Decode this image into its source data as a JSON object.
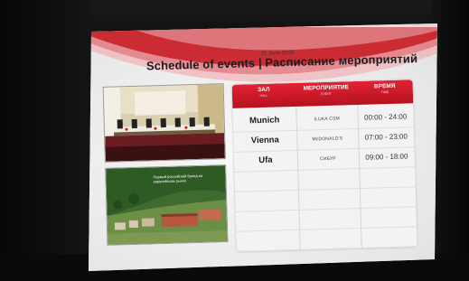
{
  "sign": {
    "date": "15 June 2018",
    "title": "Schedule of events | Расписание мероприятий",
    "headers": {
      "hall_ru": "ЗАЛ",
      "hall_en": "HALL",
      "event_ru": "МЕРОПРИЯТИЕ",
      "event_en": "EVENT",
      "time_ru": "ВРЕМЯ",
      "time_en": "TIME"
    },
    "rows": [
      {
        "hall": "Munich",
        "event": "ILUKA CSM",
        "time": "00:00 - 24:00"
      },
      {
        "hall": "Vienna",
        "event": "McDONALD'S",
        "time": "07:00 - 23:00"
      },
      {
        "hall": "Ufa",
        "event": "СИБУР",
        "time": "09:00 - 18:00"
      }
    ],
    "photo2_caption": "Первый российский бренд на европейском рынке"
  },
  "colors": {
    "accent_red": "#c8171f",
    "screen_bg": "#ececec"
  }
}
